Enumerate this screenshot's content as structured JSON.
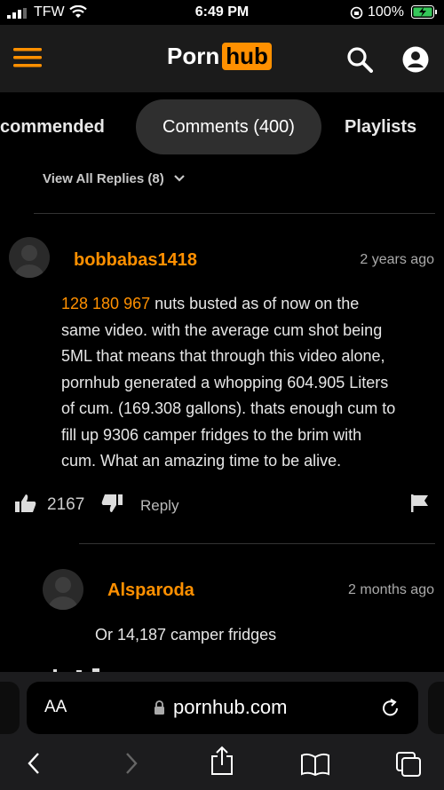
{
  "status": {
    "carrier": "TFW",
    "time": "6:49 PM",
    "battery": "100%"
  },
  "header": {
    "logo_part1": "Porn",
    "logo_part2": "hub"
  },
  "tabs": [
    "commended",
    "Comments (400)",
    "Playlists"
  ],
  "view_all": "View All Replies (8)",
  "comment1": {
    "username": "bobbabas1418",
    "date": "2 years ago",
    "highlight": "128 180 967",
    "lines": [
      " nuts busted as of now on the",
      "same video. with the average cum shot being",
      "5ML that means that through this video alone,",
      "pornhub generated a whopping 604.905 Liters",
      "of cum. (169.308 gallons). thats enough cum to",
      "fill up 9306 camper fridges to the brim with",
      "cum. What an amazing time to be alive."
    ],
    "likes": "2167",
    "reply": "Reply"
  },
  "reply1": {
    "username": "Alsparoda",
    "date": "2 months ago",
    "text": "Or 14,187 camper fridges"
  },
  "browser": {
    "aa": "AA",
    "url": "pornhub.com"
  },
  "colors": {
    "accent": "#ff9000",
    "background": "#000000",
    "header": "#1b1b1b"
  }
}
